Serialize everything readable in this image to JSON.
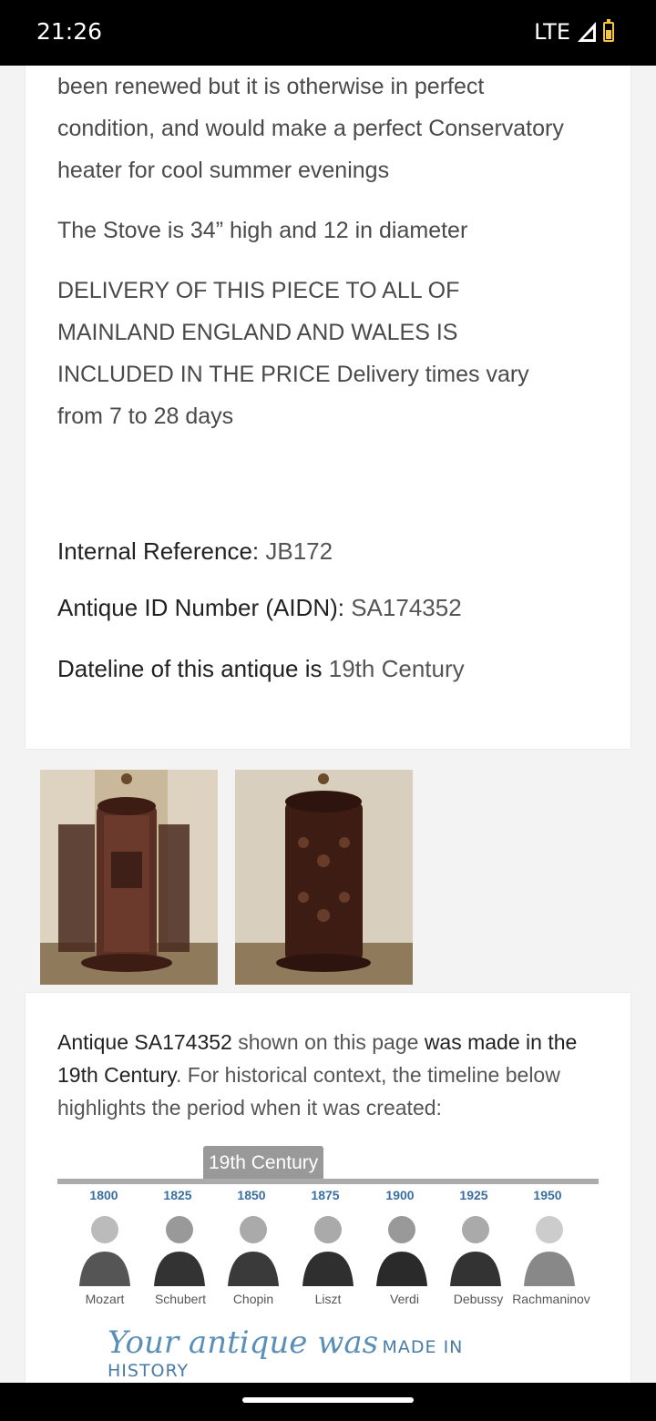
{
  "status_bar": {
    "time": "21:26",
    "network": "LTE"
  },
  "description": {
    "para1": "been renewed but it is otherwise in perfect condition, and would make a perfect Conservatory heater for cool summer evenings",
    "para2": "The Stove is 34” high and 12 in diameter",
    "para3": "DELIVERY OF THIS PIECE TO ALL OF MAINLAND ENGLAND AND WALES IS INCLUDED IN THE PRICE Delivery times vary from 7 to 28 days"
  },
  "details": {
    "internal_ref_label": "Internal Reference:",
    "internal_ref_value": "JB172",
    "aidn_label": "Antique ID Number (AIDN):",
    "aidn_value": "SA174352",
    "dateline_label": "Dateline of this antique is",
    "dateline_value": "19th Century"
  },
  "context": {
    "part1": "Antique SA174352",
    "part2": " shown on this page ",
    "part3": "was made in the 19th Century",
    "part4": ". For historical context, the timeline below highlights the period when it was created:"
  },
  "timeline": {
    "badge": "19th Century",
    "years": [
      "1800",
      "1825",
      "1850",
      "1875",
      "1900",
      "1925",
      "1950"
    ],
    "composers": [
      "Mozart",
      "Schubert",
      "Chopin",
      "Liszt",
      "Verdi",
      "Debussy",
      "Rachmaninov"
    ],
    "banner_script": "Your antique was",
    "banner_caps": "MADE IN HISTORY"
  }
}
